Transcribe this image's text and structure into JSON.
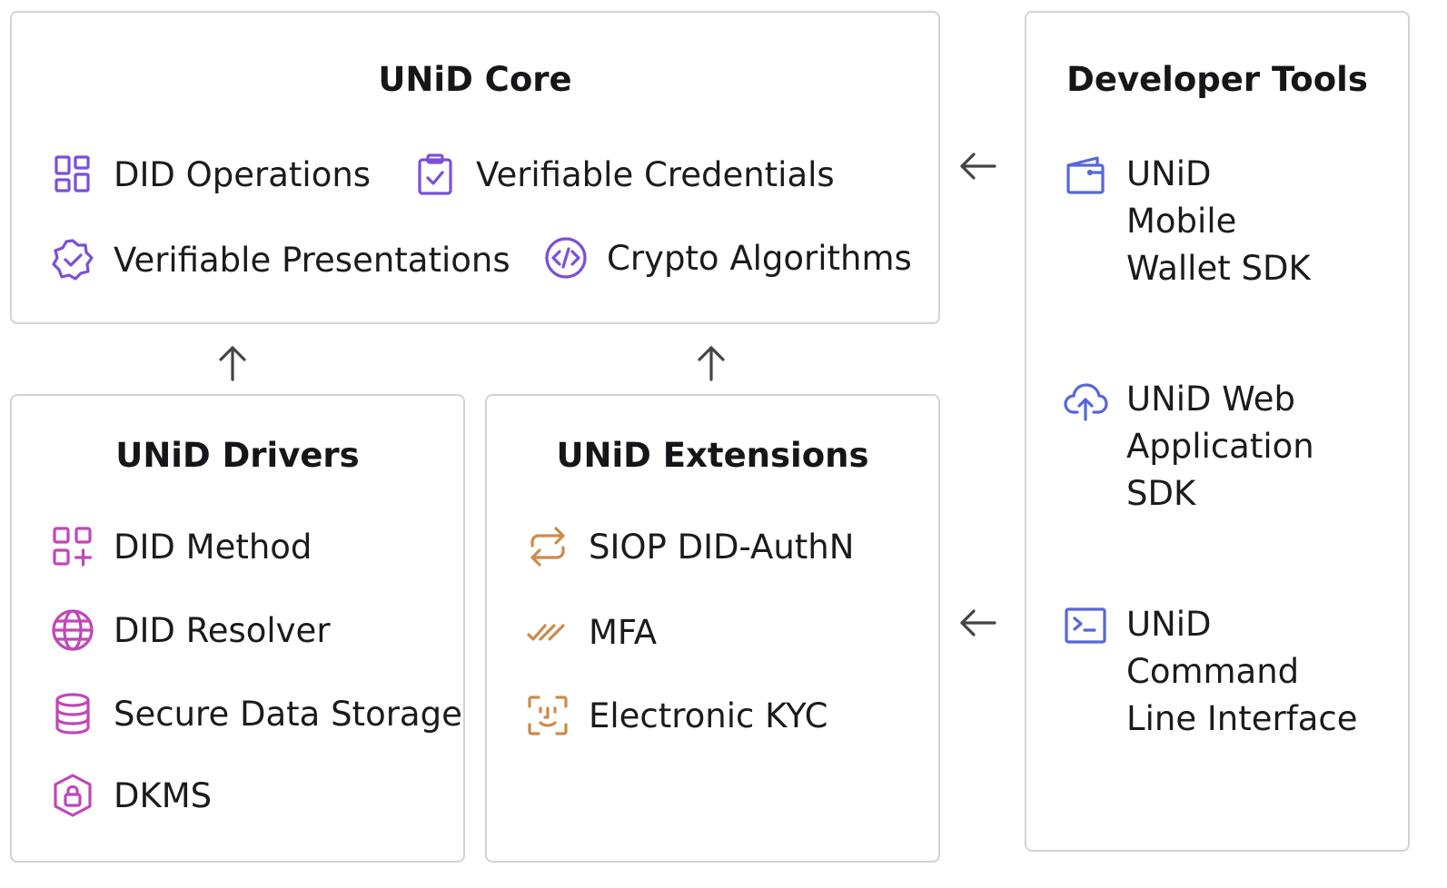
{
  "colors": {
    "core_icon": "#7b4fd8",
    "drivers_icon": "#c047b9",
    "extensions_icon": "#cd8a4a",
    "tools_icon": "#5568d8",
    "arrow": "#444444",
    "border": "#d3d3d6"
  },
  "core": {
    "title": "UNiD Core",
    "items": [
      {
        "label": "DID Operations",
        "icon": "dashboard-grid-icon"
      },
      {
        "label": "Verifiable Credentials",
        "icon": "clipboard-check-icon"
      },
      {
        "label": "Verifiable Presentations",
        "icon": "badge-check-icon"
      },
      {
        "label": "Crypto Algorithms",
        "icon": "code-circle-icon"
      }
    ]
  },
  "drivers": {
    "title": "UNiD Drivers",
    "items": [
      {
        "label": "DID Method",
        "icon": "grid-plus-icon"
      },
      {
        "label": "DID Resolver",
        "icon": "globe-icon"
      },
      {
        "label": "Secure Data Storage",
        "icon": "database-icon"
      },
      {
        "label": "DKMS",
        "icon": "shield-lock-icon"
      }
    ]
  },
  "extensions": {
    "title": "UNiD Extensions",
    "items": [
      {
        "label": "SIOP DID-AuthN",
        "icon": "repeat-icon"
      },
      {
        "label": "MFA",
        "icon": "double-check-icon"
      },
      {
        "label": "Electronic KYC",
        "icon": "face-id-icon"
      }
    ]
  },
  "tools": {
    "title": "Developer Tools",
    "items": [
      {
        "lines": [
          "UNiD",
          "Mobile",
          "Wallet SDK"
        ],
        "icon": "wallet-icon"
      },
      {
        "lines": [
          "UNiD Web",
          "Application",
          "SDK"
        ],
        "icon": "cloud-upload-icon"
      },
      {
        "lines": [
          "UNiD",
          "Command",
          "Line Interface"
        ],
        "icon": "terminal-icon"
      }
    ]
  }
}
